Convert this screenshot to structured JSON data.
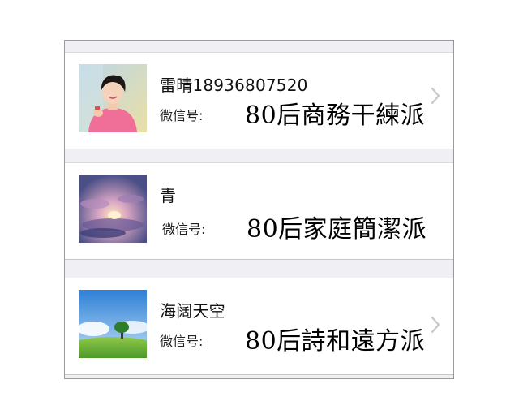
{
  "contacts": [
    {
      "name": "雷晴18936807520",
      "wechat_label": "微信号:",
      "tagline": "80后商務干練派",
      "avatar_icon": "person-photo",
      "has_chevron": true
    },
    {
      "name": "青",
      "wechat_label": "微信号:",
      "tagline": "80后家庭簡潔派",
      "avatar_icon": "sunset-cloud-photo",
      "has_chevron": false
    },
    {
      "name": "海阔天空",
      "wechat_label": "微信号:",
      "tagline": "80后詩和遠方派",
      "avatar_icon": "sky-grass-tree-photo",
      "has_chevron": true
    }
  ],
  "colors": {
    "page_bg": "#ffffff",
    "list_bg": "#efeff4",
    "frame_border": "#9a9a9a",
    "chevron": "#c7c7cc"
  }
}
